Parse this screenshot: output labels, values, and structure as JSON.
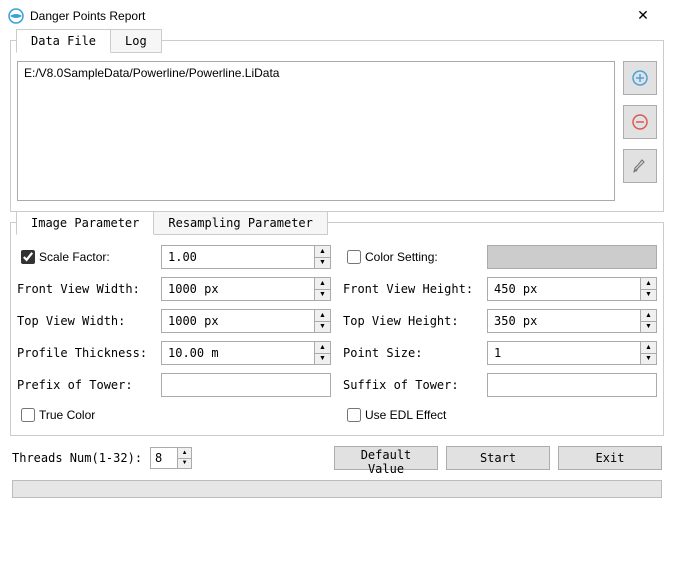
{
  "window": {
    "title": "Danger Points Report",
    "close_label": "Close"
  },
  "icons": {
    "add": "add-icon",
    "remove": "remove-icon",
    "clear": "clear-icon",
    "app": "app-icon"
  },
  "tabs_top": {
    "data_file": "Data File",
    "log": "Log",
    "active": "data_file"
  },
  "file_list": {
    "items": [
      "E:/V8.0SampleData/Powerline/Powerline.LiData"
    ]
  },
  "tabs_param": {
    "image": "Image Parameter",
    "resampling": "Resampling Parameter",
    "active": "image"
  },
  "params": {
    "scale_factor_label": "Scale Factor:",
    "scale_factor_value": "1.00",
    "scale_factor_checked": true,
    "color_setting_label": "Color Setting:",
    "color_setting_checked": false,
    "color_setting_swatch": "#cccccc",
    "front_view_width_label": "Front View Width:",
    "front_view_width_value": "1000 px",
    "front_view_height_label": "Front View Height:",
    "front_view_height_value": "450 px",
    "top_view_width_label": "Top View Width:",
    "top_view_width_value": "1000 px",
    "top_view_height_label": "Top View Height:",
    "top_view_height_value": "350 px",
    "profile_thickness_label": "Profile Thickness:",
    "profile_thickness_value": "10.00 m",
    "point_size_label": "Point Size:",
    "point_size_value": "1",
    "prefix_tower_label": "Prefix of Tower:",
    "prefix_tower_value": "",
    "suffix_tower_label": "Suffix of Tower:",
    "suffix_tower_value": "",
    "true_color_label": "True Color",
    "true_color_checked": false,
    "use_edl_label": "Use EDL Effect",
    "use_edl_checked": false
  },
  "footer": {
    "threads_label": "Threads Num(1-32):",
    "threads_value": "8",
    "default_value": "Default Value",
    "start": "Start",
    "exit": "Exit"
  }
}
